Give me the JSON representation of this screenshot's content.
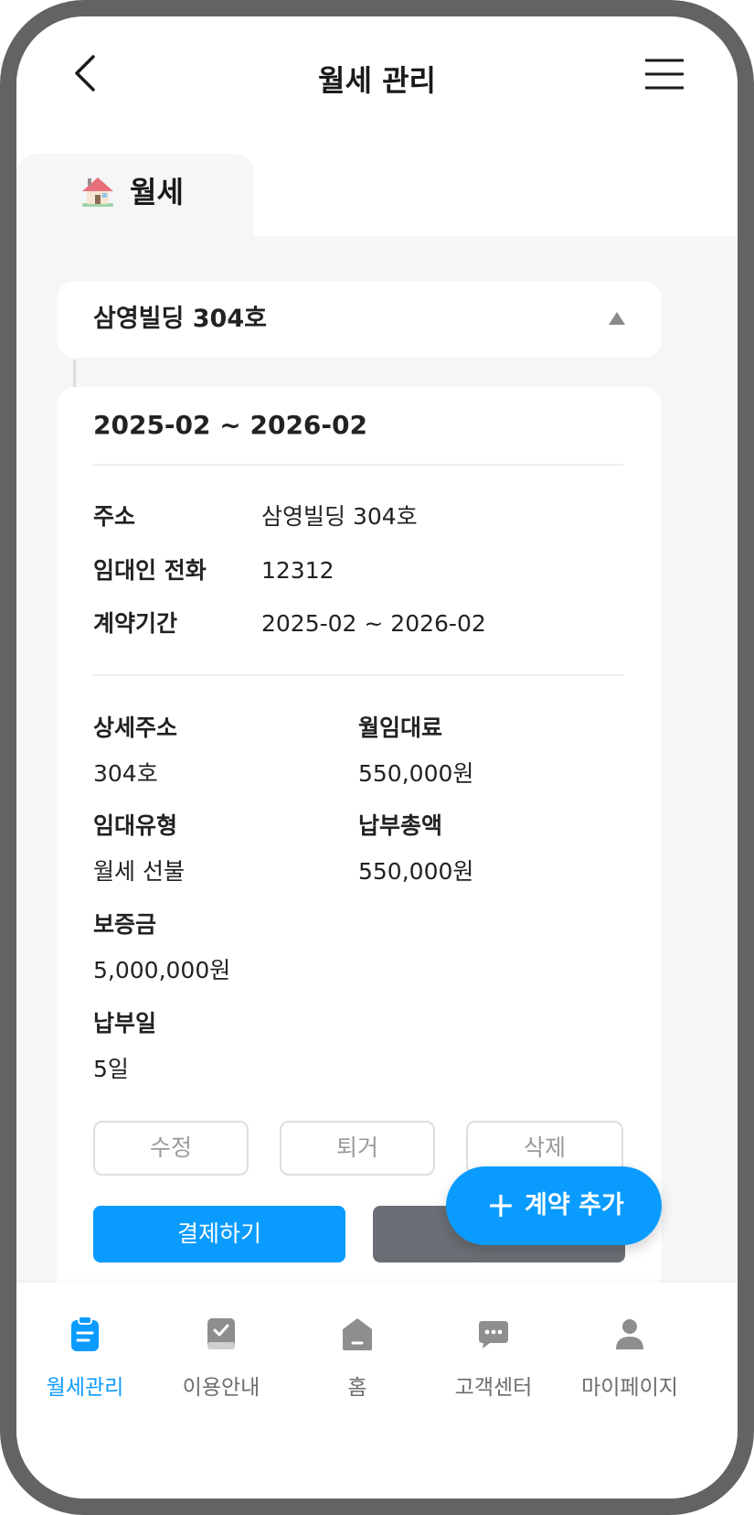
{
  "header": {
    "title": "월세 관리",
    "back_icon": "chevron-left-icon",
    "menu_icon": "hamburger-menu-icon"
  },
  "tabs": [
    {
      "label": "월세",
      "icon": "house-icon",
      "active": true
    }
  ],
  "property": {
    "name": "삼영빌딩 304호",
    "expanded": true
  },
  "contract": {
    "period": "2025-02 ~ 2026-02",
    "summary": [
      {
        "label": "주소",
        "value": "삼영빌딩  304호"
      },
      {
        "label": "임대인 전화",
        "value": "12312"
      },
      {
        "label": "계약기간",
        "value": "2025-02 ~ 2026-02"
      }
    ],
    "details": {
      "detail_address": {
        "label": "상세주소",
        "value": "304호"
      },
      "monthly_rent": {
        "label": "월임대료",
        "value": "550,000원"
      },
      "lease_type": {
        "label": "임대유형",
        "value": "월세 선불"
      },
      "total_payment": {
        "label": "납부총액",
        "value": "550,000원"
      },
      "deposit": {
        "label": "보증금",
        "value": "5,000,000원"
      },
      "payment_day": {
        "label": "납부일",
        "value": "5일"
      }
    },
    "actions": {
      "edit": "수정",
      "move_out": "퇴거",
      "delete": "삭제",
      "pay": "결제하기"
    }
  },
  "fab": {
    "icon": "plus-icon",
    "label": "계약 추가"
  },
  "bottom_nav": [
    {
      "label": "월세관리",
      "icon": "clipboard-icon",
      "active": true
    },
    {
      "label": "이용안내",
      "icon": "book-check-icon",
      "active": false
    },
    {
      "label": "홈",
      "icon": "home-icon",
      "active": false
    },
    {
      "label": "고객센터",
      "icon": "chat-bubble-icon",
      "active": false
    },
    {
      "label": "마이페이지",
      "icon": "person-icon",
      "active": false
    }
  ],
  "colors": {
    "accent": "#0a9bff",
    "frame": "#656262",
    "background": "#f5f6f8",
    "inactive_nav": "#6d6d6d",
    "secondary_button": "#6b6f75"
  }
}
